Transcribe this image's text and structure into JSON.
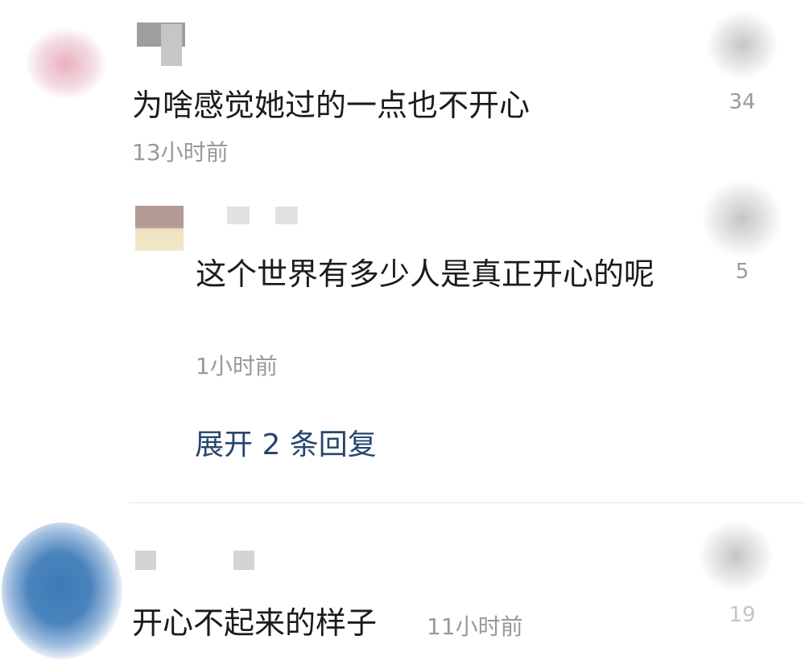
{
  "comments": [
    {
      "text": "为啥感觉她过的一点也不开心",
      "time": "13小时前",
      "likes": "34",
      "icon": "like-icon"
    },
    {
      "text": "这个世界有多少人是真正开心的呢",
      "time": "1小时前",
      "likes": "5",
      "icon": "like-icon",
      "is_reply": true
    },
    {
      "text": "开心不起来的样子",
      "time": "11小时前",
      "likes": "19",
      "icon": "like-icon"
    }
  ],
  "expand_replies_label": "展开 2 条回复",
  "colors": {
    "expand_link": "#27466e",
    "timestamp": "#999999",
    "like_count": "#9a9a9a"
  }
}
